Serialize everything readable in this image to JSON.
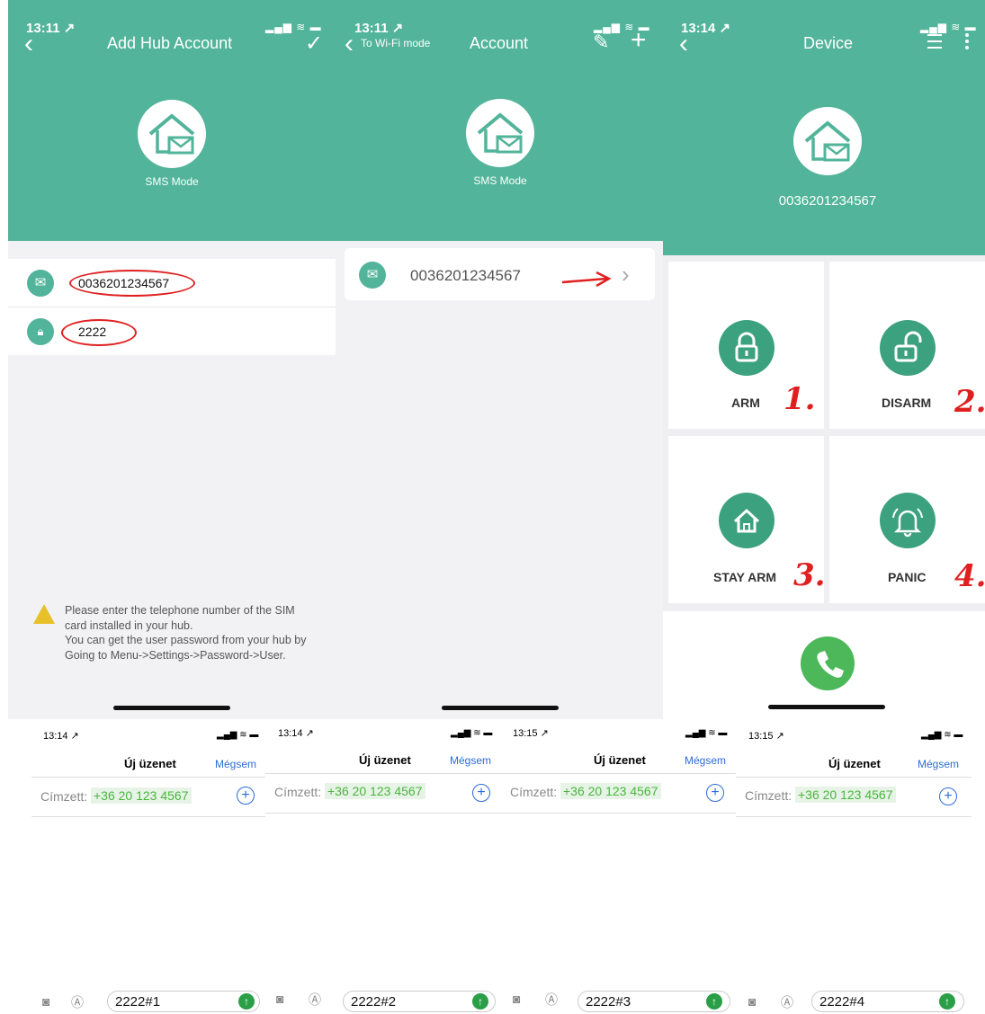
{
  "phone1": {
    "time": "13:11 ↗",
    "status": "▂▄▆ ≋ ▬",
    "back": "‹",
    "title": "Add Hub Account",
    "check": "✓",
    "mode_caption": "SMS Mode",
    "phone_value": "0036201234567",
    "password_value": "2222",
    "hint": "Please enter the telephone number of the SIM card installed in your hub.\nYou can get the user password from your hub by Going to Menu->Settings->Password->User."
  },
  "phone2": {
    "time": "13:11 ↗",
    "status": "▂▄▆ ≋ ▬",
    "back": "‹",
    "back_label": "To Wi-Fi mode",
    "title": "Account",
    "edit": "✎",
    "add": "+",
    "mode_caption": "SMS Mode",
    "account_number": "0036201234567",
    "chevron": "›"
  },
  "phone3": {
    "time": "13:14 ↗",
    "status": "▂▄▆ ≋ ▬",
    "back": "‹",
    "title": "Device",
    "device_number": "0036201234567",
    "tiles": [
      {
        "label": "ARM",
        "mark": "1."
      },
      {
        "label": "DISARM",
        "mark": "2."
      },
      {
        "label": "STAY ARM",
        "mark": "3."
      },
      {
        "label": "PANIC",
        "mark": "4."
      }
    ]
  },
  "sms": [
    {
      "time": "13:14 ↗",
      "title": "Új üzenet",
      "cancel": "Mégsem",
      "to": "Címzett:",
      "number": "+36 20 123 4567",
      "message": "2222#1"
    },
    {
      "time": "13:14 ↗",
      "title": "Új üzenet",
      "cancel": "Mégsem",
      "to": "Címzett:",
      "number": "+36 20 123 4567",
      "message": "2222#2"
    },
    {
      "time": "13:15 ↗",
      "title": "Új üzenet",
      "cancel": "Mégsem",
      "to": "Címzett:",
      "number": "+36 20 123 4567",
      "message": "2222#3"
    },
    {
      "time": "13:15 ↗",
      "title": "Új üzenet",
      "cancel": "Mégsem",
      "to": "Címzett:",
      "number": "+36 20 123 4567",
      "message": "2222#4"
    }
  ],
  "sms_status": "▂▄▆ ≋ ▬",
  "colors": {
    "header": "#52b49a",
    "icon_green": "#3ca17f",
    "call_green": "#4cb85a",
    "annotation_red": "#e02020"
  }
}
